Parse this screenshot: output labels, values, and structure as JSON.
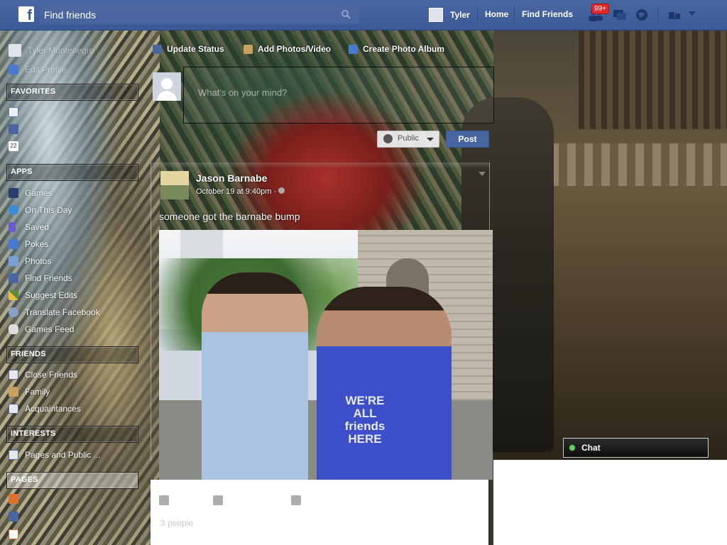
{
  "topbar": {
    "logo": "f",
    "search_text": "Find friends",
    "user_name": "Tyler",
    "home": "Home",
    "find_friends": "Find Friends",
    "friend_requests_badge": "99+"
  },
  "sidebar": {
    "profile_name": "Tyler Montenegro",
    "edit_profile": "Edit Profile",
    "favorites_header": "FAVORITES",
    "favorites": [
      {
        "label": ""
      },
      {
        "label": ""
      },
      {
        "label": ""
      }
    ],
    "apps_header": "APPS",
    "apps": [
      {
        "label": "Games"
      },
      {
        "label": "On This Day"
      },
      {
        "label": "Saved"
      },
      {
        "label": "Pokes"
      },
      {
        "label": "Photos"
      },
      {
        "label": "Find Friends"
      },
      {
        "label": "Suggest Edits"
      },
      {
        "label": "Translate Facebook"
      },
      {
        "label": "Games Feed"
      }
    ],
    "friends_header": "FRIENDS",
    "friends": [
      {
        "label": "Close Friends"
      },
      {
        "label": "Family"
      },
      {
        "label": "Acquaintances"
      }
    ],
    "interests_header": "INTERESTS",
    "interests": [
      {
        "label": "Pages and Public ..."
      }
    ],
    "pages_header": "PAGES"
  },
  "composer": {
    "tabs": [
      {
        "label": "Update Status"
      },
      {
        "label": "Add Photos/Video"
      },
      {
        "label": "Create Photo Album"
      }
    ],
    "placeholder": "What's on your mind?",
    "audience": "Public",
    "post_button": "Post"
  },
  "story": {
    "author": "Jason Barnabe",
    "timestamp": "October 19 at 9:40pm · ",
    "text": "someone got the barnabe bump",
    "photo_shirt_text": "WE'RE ALL friends HERE",
    "likes": "3 people"
  },
  "chat": {
    "label": "Chat"
  },
  "colors": {
    "brand": "#3b5998",
    "badge": "#e02a2a"
  }
}
